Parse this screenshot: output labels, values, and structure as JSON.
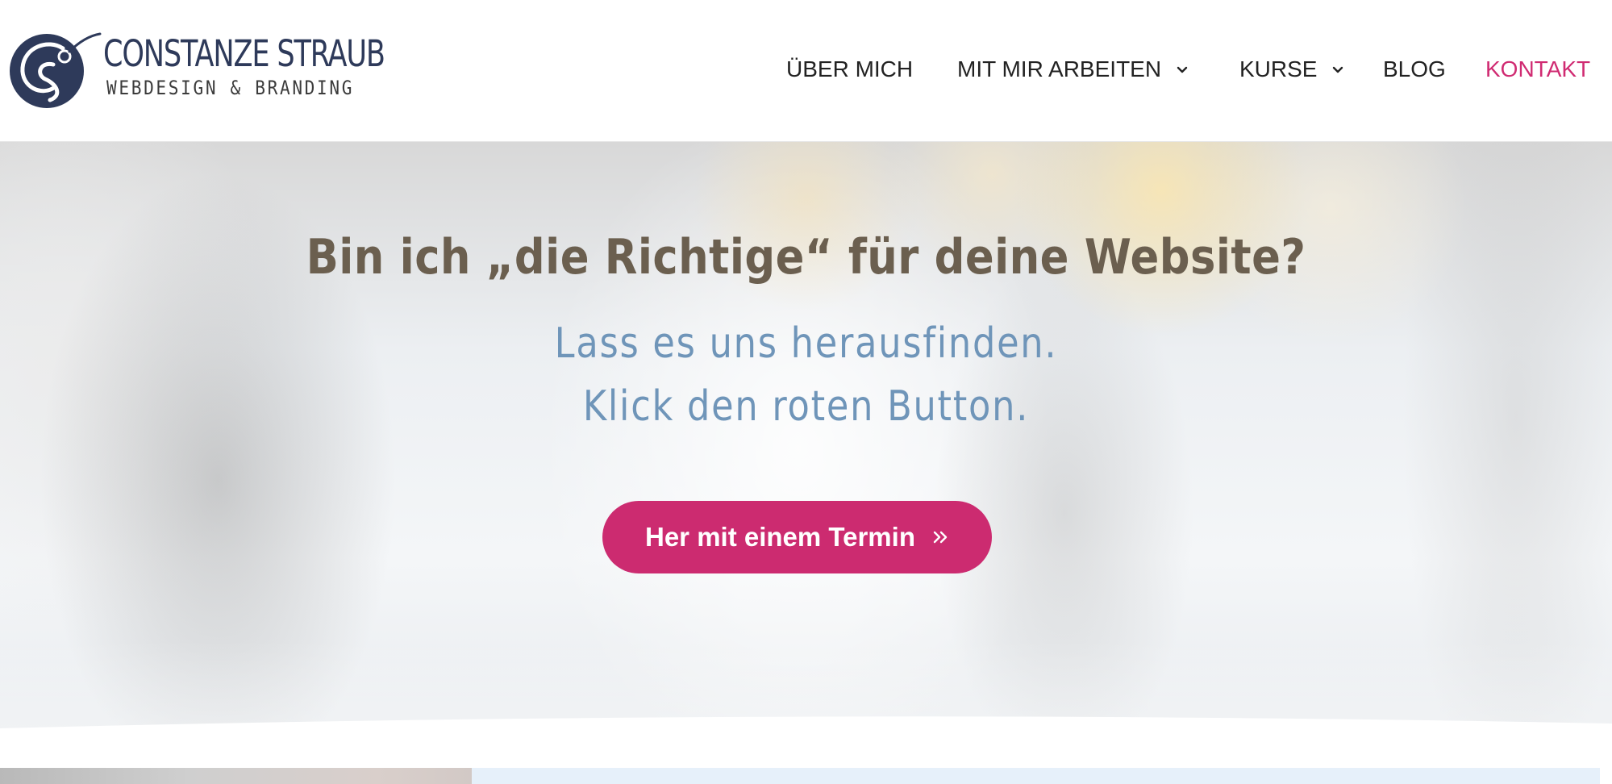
{
  "brand": {
    "name": "CONSTANZE STRAUB",
    "tagline": "WEBDESIGN & BRANDING",
    "color": "#2e3a5a"
  },
  "nav": {
    "items": [
      {
        "label": "ÜBER MICH",
        "has_dropdown": false,
        "active": false
      },
      {
        "label": "MIT MIR ARBEITEN",
        "has_dropdown": true,
        "active": false
      },
      {
        "label": "KURSE",
        "has_dropdown": true,
        "active": false
      },
      {
        "label": "BLOG",
        "has_dropdown": false,
        "active": false
      },
      {
        "label": "KONTAKT",
        "has_dropdown": false,
        "active": true
      }
    ],
    "active_color": "#d02b72",
    "dropdown_icon": "chevron-down-icon"
  },
  "hero": {
    "title": "Bin ich „die Richtige“ für deine Website?",
    "subtitle_line1": "Lass es uns herausfinden.",
    "subtitle_line2": "Klick den roten Button.",
    "cta_label": "Her mit einem Termin",
    "cta_icon": "double-chevron-right-icon",
    "title_color": "#6b5f4f",
    "subtitle_color": "#6f95b9",
    "cta_color": "#cc2b70"
  }
}
